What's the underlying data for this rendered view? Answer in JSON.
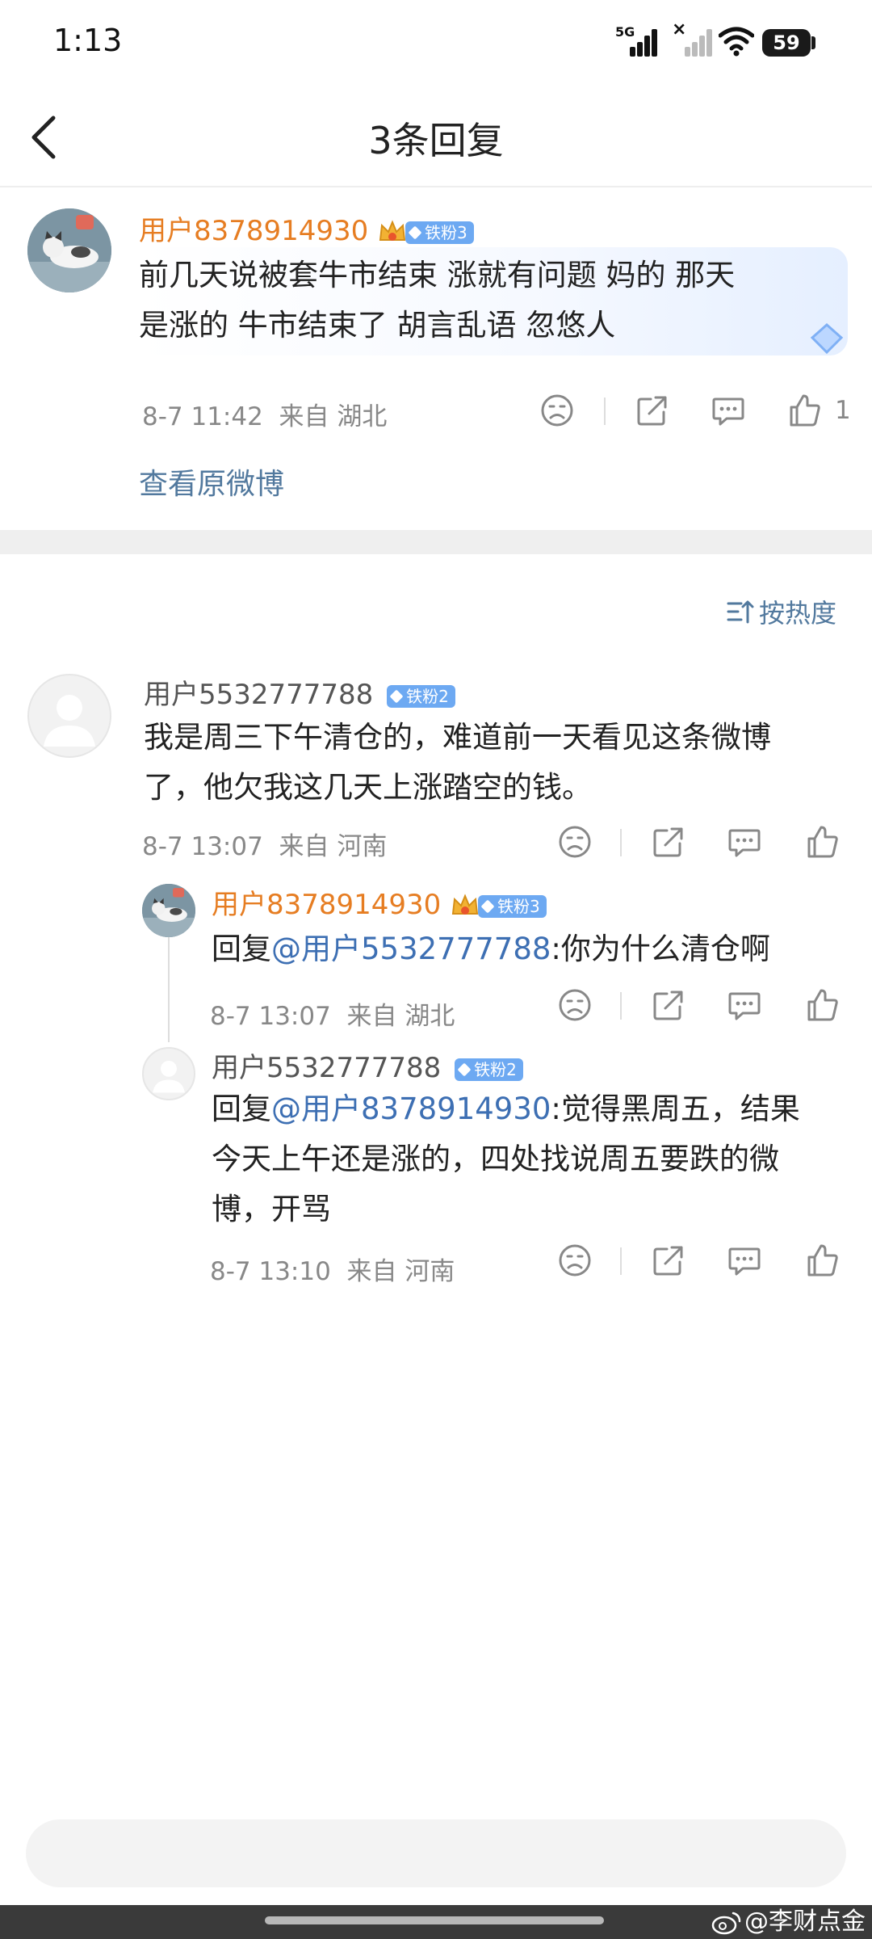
{
  "status_bar": {
    "time": "1:13",
    "network": "5G",
    "battery": "59"
  },
  "header": {
    "title": "3条回复"
  },
  "root_comment": {
    "username": "用户8378914930",
    "badge": "铁粉3",
    "text_line1": "前几天说被套牛市结束 涨就有问题  妈的 那天",
    "text_line2": "是涨的 牛市结束了 胡言乱语 忽悠人",
    "time": "8-7 11:42",
    "from": "来自 湖北",
    "like_count": "1",
    "view_original": "查看原微博"
  },
  "sort": {
    "label": "按热度"
  },
  "replies": [
    {
      "username": "用户5532777788",
      "badge": "铁粉2",
      "line1": "我是周三下午清仓的，难道前一天看见这条微博",
      "line2": "了，他欠我这几天上涨踏空的钱。",
      "time": "8-7 13:07",
      "from": "来自 河南"
    }
  ],
  "sub_replies": [
    {
      "username": "用户8378914930",
      "badge": "铁粉3",
      "prefix": "回复",
      "mention": "@用户5532777788",
      "text": ":你为什么清仓啊",
      "time": "8-7 13:07",
      "from": "来自 湖北"
    },
    {
      "username": "用户5532777788",
      "badge": "铁粉2",
      "prefix": "回复",
      "mention": "@用户8378914930",
      "text_line1": ":觉得黑周五，结果",
      "text_line2": "今天上午还是涨的，四处找说周五要跌的微",
      "text_line3": "博，开骂",
      "time": "8-7 13:10",
      "from": "来自 河南"
    }
  ],
  "watermark": "@李财点金",
  "colors": {
    "accent_orange": "#e67d22",
    "link_blue": "#52799e",
    "mention_blue": "#3d6fb3",
    "badge_blue": "#6da9f2"
  }
}
